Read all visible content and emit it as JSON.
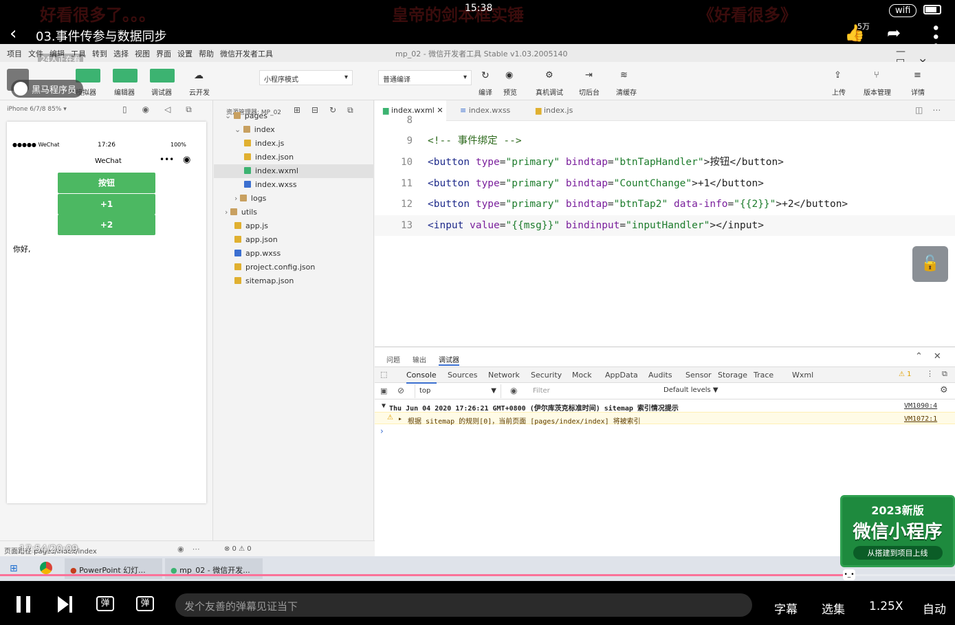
{
  "player": {
    "clock": "15:38",
    "network": "wifi",
    "title": "03.事件传参与数据同步",
    "like_count": "5万",
    "danmu_ghost_left": "好看很多了。。。",
    "danmu_ghost_mid": "皇帝的剑本框实锤",
    "danmu_ghost_right": "《好看很多》",
    "viewers": "24人正在看",
    "watermark": "黑马程序员",
    "time_progress": "17:54/20:09",
    "progress": 0.889,
    "danmu_placeholder": "发个友善的弹幕见证当下",
    "subtitle_label": "字幕",
    "episodes_label": "选集",
    "speed_label": "1.25X",
    "quality_label": "自动"
  },
  "ide": {
    "menu": [
      "项目",
      "文件",
      "编辑",
      "工具",
      "转到",
      "选择",
      "视图",
      "界面",
      "设置",
      "帮助",
      "微信开发者工具"
    ],
    "window_title": "mp_02 - 微信开发者工具 Stable v1.03.2005140",
    "toolbar_labels": {
      "simulator": "模拟器",
      "editor": "编辑器",
      "debugger": "调试器",
      "cloud": "云开发"
    },
    "mode_select": "小程序模式",
    "compile_select": "普通编译",
    "actions": [
      "编译",
      "预览",
      "真机调试",
      "切后台",
      "清缓存"
    ],
    "right_actions": [
      "上传",
      "版本管理",
      "详情"
    ],
    "device": "iPhone 6/7/8 85% ▾",
    "explorer_title": "资源管理器: MP_02",
    "tree": [
      {
        "label": "pages",
        "indent": 0,
        "kind": "folder"
      },
      {
        "label": "index",
        "indent": 1,
        "kind": "folder"
      },
      {
        "label": "index.js",
        "indent": 2,
        "kind": "js"
      },
      {
        "label": "index.json",
        "indent": 2,
        "kind": "json"
      },
      {
        "label": "index.wxml",
        "indent": 2,
        "kind": "wxml",
        "selected": true
      },
      {
        "label": "index.wxss",
        "indent": 2,
        "kind": "wxss"
      },
      {
        "label": "logs",
        "indent": 1,
        "kind": "folder"
      },
      {
        "label": "utils",
        "indent": 0,
        "kind": "folder"
      },
      {
        "label": "app.js",
        "indent": 1,
        "kind": "js"
      },
      {
        "label": "app.json",
        "indent": 1,
        "kind": "json"
      },
      {
        "label": "app.wxss",
        "indent": 1,
        "kind": "wxss"
      },
      {
        "label": "project.config.json",
        "indent": 1,
        "kind": "json"
      },
      {
        "label": "sitemap.json",
        "indent": 1,
        "kind": "json"
      }
    ],
    "tabs": [
      "index.wxml",
      "index.wxss",
      "index.js"
    ],
    "code": {
      "line8": "8",
      "line9": "9",
      "comment": "<!-- 事件绑定 -->",
      "line10": "10",
      "b1_type": "\"primary\"",
      "b1_bind": "\"btnTapHandler\"",
      "b1_text": ">按钮</button>",
      "line11": "11",
      "b2_type": "\"primary\"",
      "b2_bind": "\"CountChange\"",
      "b2_text": ">+1</button>",
      "line12": "12",
      "b3_type": "\"primary\"",
      "b3_bind": "\"btnTap2\"",
      "b3_info": "\"{{2}}\"",
      "b3_text": ">+2</button>",
      "line13": "13",
      "in_value": "\"{{msg}}\"",
      "in_bind": "\"inputHandler\"",
      "in_text": "></input>"
    },
    "phone": {
      "carrier": "●●●●● WeChat",
      "time": "17:26",
      "battery": "100%",
      "nav_title": "WeChat",
      "btn1": "按钮",
      "btn2": "+1",
      "btn3": "+2",
      "text": "你好,"
    },
    "console": {
      "panel_tabs": [
        "问题",
        "输出",
        "调试器"
      ],
      "dev_tabs": [
        "Console",
        "Sources",
        "Network",
        "Security",
        "Mock",
        "AppData",
        "Audits",
        "Sensor",
        "Storage",
        "Trace",
        "Wxml"
      ],
      "warn_count": "1",
      "context": "top",
      "filter_placeholder": "Filter",
      "levels": "Default levels ▼",
      "line1": "Thu Jun 04 2020 17:26:21 GMT+0800 (伊尔库茨克标准时间) sitemap 索引情况提示",
      "line1_src": "VM1090:4",
      "line2": "根据 sitemap 的规则[0]，当前页面 [pages/index/index] 将被索引",
      "line2_src": "VM1072:1"
    },
    "status": {
      "path": "页面路径 pages/index/index",
      "errors": "⊗ 0 ⚠ 0"
    },
    "taskbar": {
      "app1": "PowerPoint 幻灯...",
      "app2": "mp_02 - 微信开发..."
    },
    "banner": {
      "year": "2023新版",
      "title": "微信小程序",
      "sub": "从搭建到项目上线"
    }
  }
}
